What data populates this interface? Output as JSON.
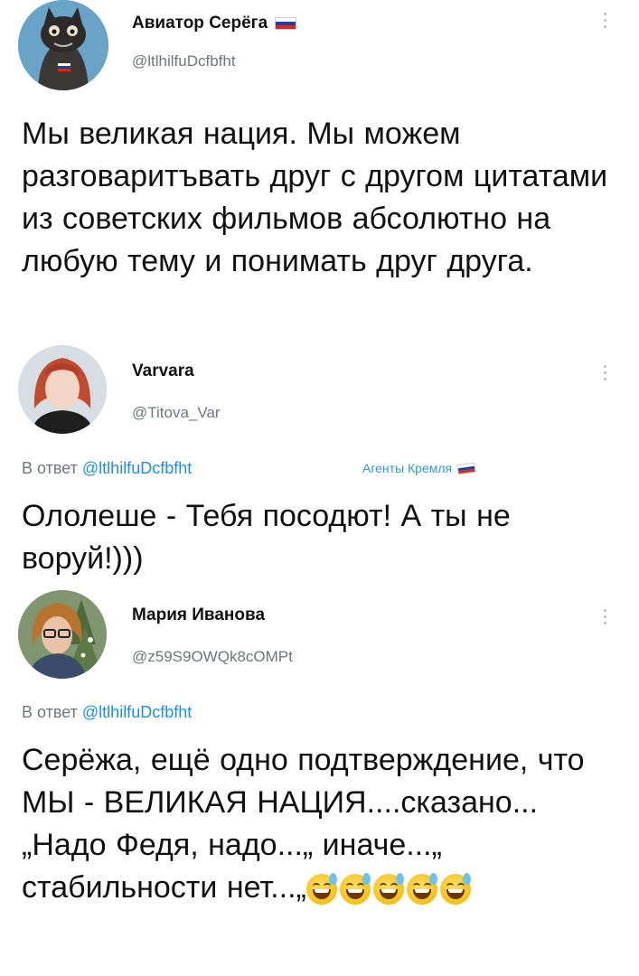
{
  "tweets": [
    {
      "name": "Авиатор Серёга",
      "flag": "russia-flag-icon",
      "handle": "@ltlhilfuDcfbfht",
      "text": "Мы великая нация. Мы можем разговаритъвать друг с другом цитатами из советских фильмов абсолютно на любую тему и понимать друг друга."
    },
    {
      "name": "Varvara",
      "handle": "@Titova_Var",
      "reply_prefix": "В ответ",
      "reply_handle": "@ltlhilfuDcfbfht",
      "tag": "Агенты Кремля",
      "text": "Ололеше - Тебя посодют! А ты не воруй!)))"
    },
    {
      "name": "Мария Иванова",
      "handle": "@z59S9OWQk8cOMPt",
      "reply_prefix": "В ответ",
      "reply_handle": "@ltlhilfuDcfbfht",
      "text": "Серёжа, ещё одно подтверждение, что МЫ - ВЕЛИКАЯ НАЦИЯ....сказано...„Надо Федя, надо...„ иначе...„ стабильности нет...„",
      "emojis": [
        "sweat-smile-icon",
        "sweat-smile-icon",
        "sweat-smile-icon",
        "sweat-smile-icon",
        "sweat-smile-icon"
      ]
    }
  ],
  "colors": {
    "handle": "#6e767d",
    "link": "#1d8fe0",
    "tag": "#2e9ad8",
    "flag_white": "#ffffff",
    "flag_blue": "#1c3faa",
    "flag_red": "#d52b1e"
  }
}
